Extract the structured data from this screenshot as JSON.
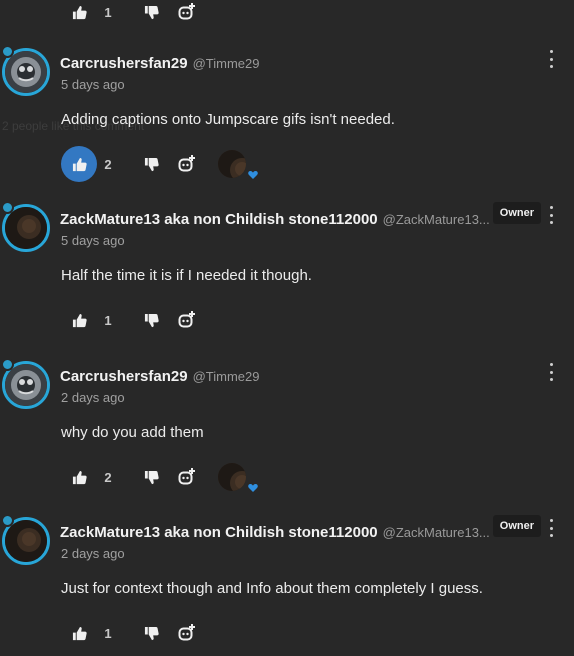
{
  "top": {
    "like_count": "1"
  },
  "comments": [
    {
      "author": "Carcrushersfan29",
      "handle": "@Timme29",
      "time": "5 days ago",
      "text": "Adding captions onto Jumpscare gifs isn't needed.",
      "likes": "2",
      "liked": true,
      "hearted": true,
      "owner": ""
    },
    {
      "author": "ZackMature13 aka non Childish stone112000",
      "handle": "@ZackMature13...",
      "time": "5 days ago",
      "text": "Half the time it is if I needed it though.",
      "likes": "1",
      "liked": false,
      "hearted": false,
      "owner": "Owner"
    },
    {
      "author": "Carcrushersfan29",
      "handle": "@Timme29",
      "time": "2 days ago",
      "text": "why do you add them",
      "likes": "2",
      "liked": false,
      "hearted": true,
      "owner": ""
    },
    {
      "author": "ZackMature13 aka non Childish stone112000",
      "handle": "@ZackMature13...",
      "time": "2 days ago",
      "text": "Just for context though and Info about them completely I guess.",
      "likes": "1",
      "liked": false,
      "hearted": false,
      "owner": "Owner"
    }
  ],
  "ghost_text": "2 people like this comment",
  "colors": {
    "background": "#282828",
    "avatar_ring": "#28a6d8",
    "like_active": "#3378c2",
    "heart": "#2f8fe0"
  },
  "icons": [
    "thumbs-up-icon",
    "thumbs-down-icon",
    "reply-icon",
    "more-options-icon",
    "heart-icon"
  ]
}
